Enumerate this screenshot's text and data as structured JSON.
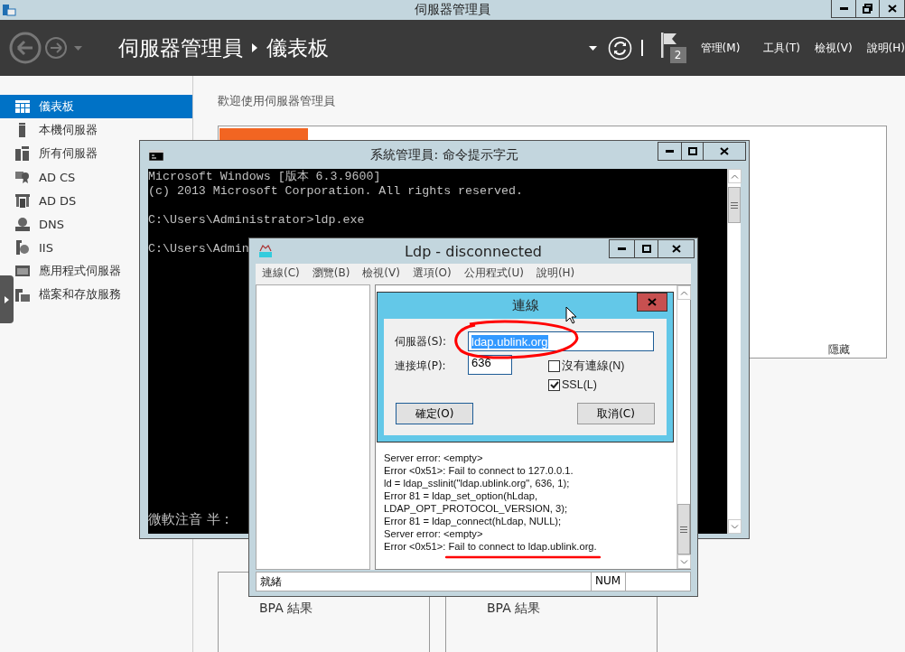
{
  "window": {
    "title": "伺服器管理員"
  },
  "header": {
    "breadcrumb": [
      "伺服器管理員",
      "儀表板"
    ],
    "notification_count": "2",
    "menus": [
      "管理(M)",
      "工具(T)",
      "檢視(V)",
      "說明(H)"
    ]
  },
  "sidebar": {
    "items": [
      {
        "label": "儀表板",
        "selected": true
      },
      {
        "label": "本機伺服器",
        "selected": false
      },
      {
        "label": "所有伺服器",
        "selected": false
      },
      {
        "label": "AD CS",
        "selected": false
      },
      {
        "label": "AD DS",
        "selected": false
      },
      {
        "label": "DNS",
        "selected": false
      },
      {
        "label": "IIS",
        "selected": false
      },
      {
        "label": "應用程式伺服器",
        "selected": false
      },
      {
        "label": "檔案和存放服務",
        "selected": false
      }
    ]
  },
  "dashboard": {
    "welcome": "歡迎使用伺服器管理員",
    "hide_link": "隱藏",
    "bpa_cards": [
      "BPA 結果",
      "BPA 結果"
    ]
  },
  "cmd_window": {
    "title": "系統管理員: 命令提示字元",
    "groups": [
      [
        "Microsoft Windows [版本 6.3.9600]",
        "(c) 2013 Microsoft Corporation. All rights reserved."
      ],
      [
        "C:\\Users\\Administrator>ldp.exe"
      ],
      [
        "C:\\Users\\Admin"
      ]
    ],
    "ime_status": "微軟注音 半 :"
  },
  "ldp_window": {
    "title": "Ldp - disconnected",
    "menus": [
      "連線(C)",
      "瀏覽(B)",
      "檢視(V)",
      "選項(O)",
      "公用程式(U)",
      "說明(H)"
    ],
    "output_lines": [
      "Server error: <empty>",
      "Error <0x51>: Fail to connect to 127.0.0.1.",
      "ld = ldap_sslinit(\"ldap.ublink.org\", 636, 1);",
      "Error 81 = ldap_set_option(hLdap,",
      "LDAP_OPT_PROTOCOL_VERSION, 3);",
      "Error 81 = ldap_connect(hLdap, NULL);",
      "Server error: <empty>",
      "Error <0x51>: Fail to connect to ldap.ublink.org."
    ],
    "status": "就緒",
    "status_num": "NUM"
  },
  "connect_dialog": {
    "title": "連線",
    "server_label": "伺服器(S):",
    "server_value": "ldap.ublink.org",
    "port_label": "連接埠(P):",
    "port_value": "636",
    "options": [
      {
        "label": "沒有連線(N)",
        "checked": false
      },
      {
        "label": "SSL(L)",
        "checked": true
      }
    ],
    "buttons": [
      "確定(O)",
      "取消(C)"
    ]
  }
}
